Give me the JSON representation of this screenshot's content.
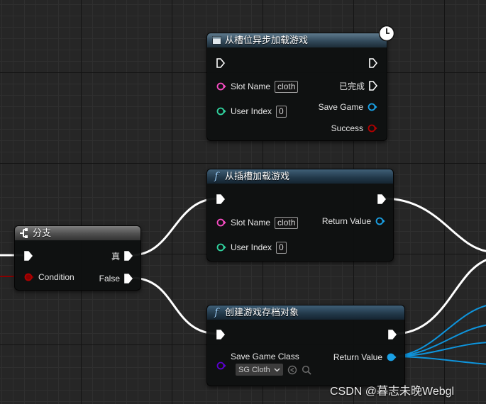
{
  "colors": {
    "exec_wire": "#ffffff",
    "string_pin": "#f94dc4",
    "int_pin": "#30d5a0",
    "object_pin": "#1aa1e6",
    "bool_pin": "#8a0000",
    "class_pin": "#5a00d0",
    "object_wire": "#0e94dc",
    "bool_wire": "#8a0000"
  },
  "nodes": {
    "async_load": {
      "title": "从槽位异步加载游戏",
      "header_icon": "node-window-icon",
      "latent_icon": "clock-icon",
      "inputs": [
        {
          "label": "Slot Name",
          "value": "cloth",
          "type": "string"
        },
        {
          "label": "User Index",
          "value": "0",
          "type": "int"
        }
      ],
      "outputs": [
        {
          "label": "已完成",
          "type": "exec"
        },
        {
          "label": "Save Game",
          "type": "object"
        },
        {
          "label": "Success",
          "type": "bool"
        }
      ]
    },
    "load_from_slot": {
      "title": "从插槽加载游戏",
      "header_icon": "function-icon",
      "inputs": [
        {
          "label": "Slot Name",
          "value": "cloth",
          "type": "string"
        },
        {
          "label": "User Index",
          "value": "0",
          "type": "int"
        }
      ],
      "outputs": [
        {
          "label": "Return Value",
          "type": "object"
        }
      ]
    },
    "branch": {
      "title": "分支",
      "header_icon": "branch-icon",
      "inputs": [
        {
          "label": "Condition",
          "type": "bool"
        }
      ],
      "outputs": [
        {
          "label": "真",
          "type": "exec"
        },
        {
          "label": "False",
          "type": "exec"
        }
      ]
    },
    "create_save": {
      "title": "创建游戏存档对象",
      "header_icon": "function-icon",
      "inputs": [
        {
          "label": "Save Game Class",
          "value": "SG Cloth",
          "type": "class"
        }
      ],
      "outputs": [
        {
          "label": "Return Value",
          "type": "object"
        }
      ]
    }
  },
  "watermark": "CSDN @暮志未晚Webgl"
}
